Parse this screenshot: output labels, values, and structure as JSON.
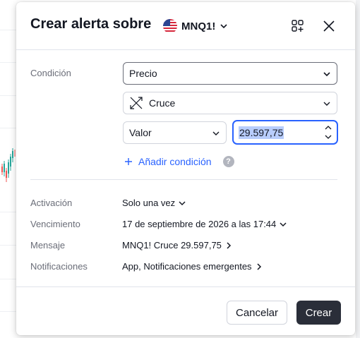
{
  "dialog": {
    "title": "Crear alerta sobre",
    "symbol": "MNQ1!",
    "icons": {
      "add": "add-watchlist-icon",
      "close": "close-icon"
    }
  },
  "condition": {
    "label": "Condición",
    "source": "Precio",
    "operator": "Cruce",
    "operator_icon": "crossing-icon",
    "value_type": "Valor",
    "value": "29.597,75",
    "add_condition": "Añadir condición",
    "help": "?"
  },
  "settings": {
    "activation": {
      "label": "Activación",
      "value": "Solo una vez"
    },
    "expiration": {
      "label": "Vencimiento",
      "value": "17 de septiembre de 2026 a las 17:44"
    },
    "message": {
      "label": "Mensaje",
      "value": "MNQ1! Cruce 29.597,75"
    },
    "notifications": {
      "label": "Notificaciones",
      "value": "App, Notificaciones emergentes"
    }
  },
  "footer": {
    "cancel": "Cancelar",
    "create": "Crear"
  },
  "colors": {
    "accent": "#2962ff",
    "primary_button": "#2a2e39",
    "border": "#d1d4dc",
    "muted_text": "#6a6d78"
  }
}
